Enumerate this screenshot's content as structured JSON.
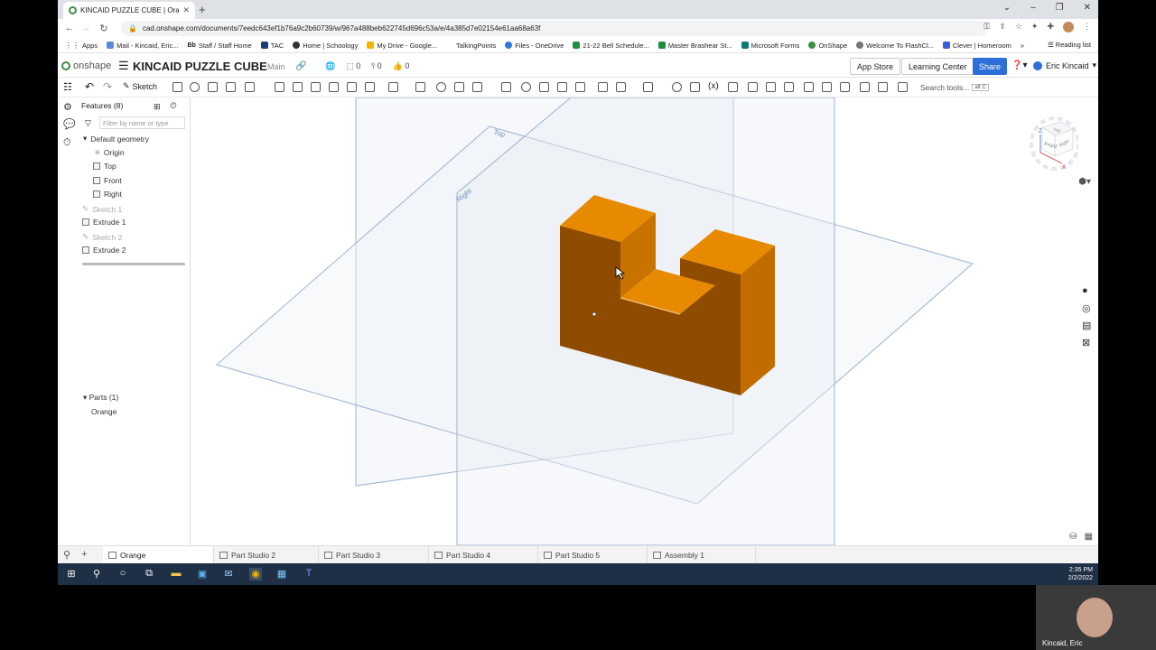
{
  "browser": {
    "tab_title": "KINCAID PUZZLE CUBE | Orange",
    "new_tab": "+",
    "url": "cad.onshape.com/documents/7eedc643ef1b76a9c2b60739/w/967a488beb622745d696c53a/e/4a385d7e02154e61aa68a63f",
    "window_controls": [
      "⌄",
      "–",
      "❐",
      "✕"
    ],
    "bookmarks": [
      "Apps",
      "Mail - Kincaid, Eric...",
      "Staff / Staff Home",
      "TAC",
      "Home | Schoology",
      "My Drive - Google...",
      "TalkingPoints",
      "Files - OneDrive",
      "21-22 Bell Schedule...",
      "Master Brashear St...",
      "Microsoft Forms",
      "OnShape",
      "Welcome To FlashCl...",
      "Clever | Homeroom",
      "»"
    ],
    "reading_list": "Reading list"
  },
  "header": {
    "logo": "onshape",
    "doc_title": "KINCAID PUZZLE CUBE",
    "branch": "Main",
    "count_versions": "0",
    "count_branches": "0",
    "count_likes": "0",
    "app_store": "App Store",
    "learning_center": "Learning Center",
    "share": "Share",
    "user": "Eric Kincaid"
  },
  "toolbar": {
    "sketch": "Sketch",
    "search_tools": "Search tools...",
    "search_shortcut": "alt C"
  },
  "features": {
    "header": "Features (8)",
    "filter_placeholder": "Filter by name or type",
    "items": [
      "Default geometry",
      "Origin",
      "Top",
      "Front",
      "Right",
      "Sketch 1",
      "Extrude 1",
      "Sketch 2",
      "Extrude 2"
    ],
    "parts_header": "Parts (1)",
    "part": "Orange"
  },
  "viewport": {
    "plane_top": "Top",
    "plane_right": "Right",
    "cube_top": "Top",
    "cube_front": "Front",
    "cube_right": "Right",
    "axis_z": "Z",
    "axis_x": "X",
    "part_color": "#e88a00"
  },
  "bottom_tabs": [
    "Orange",
    "Part Studio 2",
    "Part Studio 3",
    "Part Studio 4",
    "Part Studio 5",
    "Assembly 1"
  ],
  "taskbar": {
    "time": "2:35 PM",
    "date": "2/2/2022"
  },
  "webcam": {
    "name": "Kincaid, Eric"
  }
}
